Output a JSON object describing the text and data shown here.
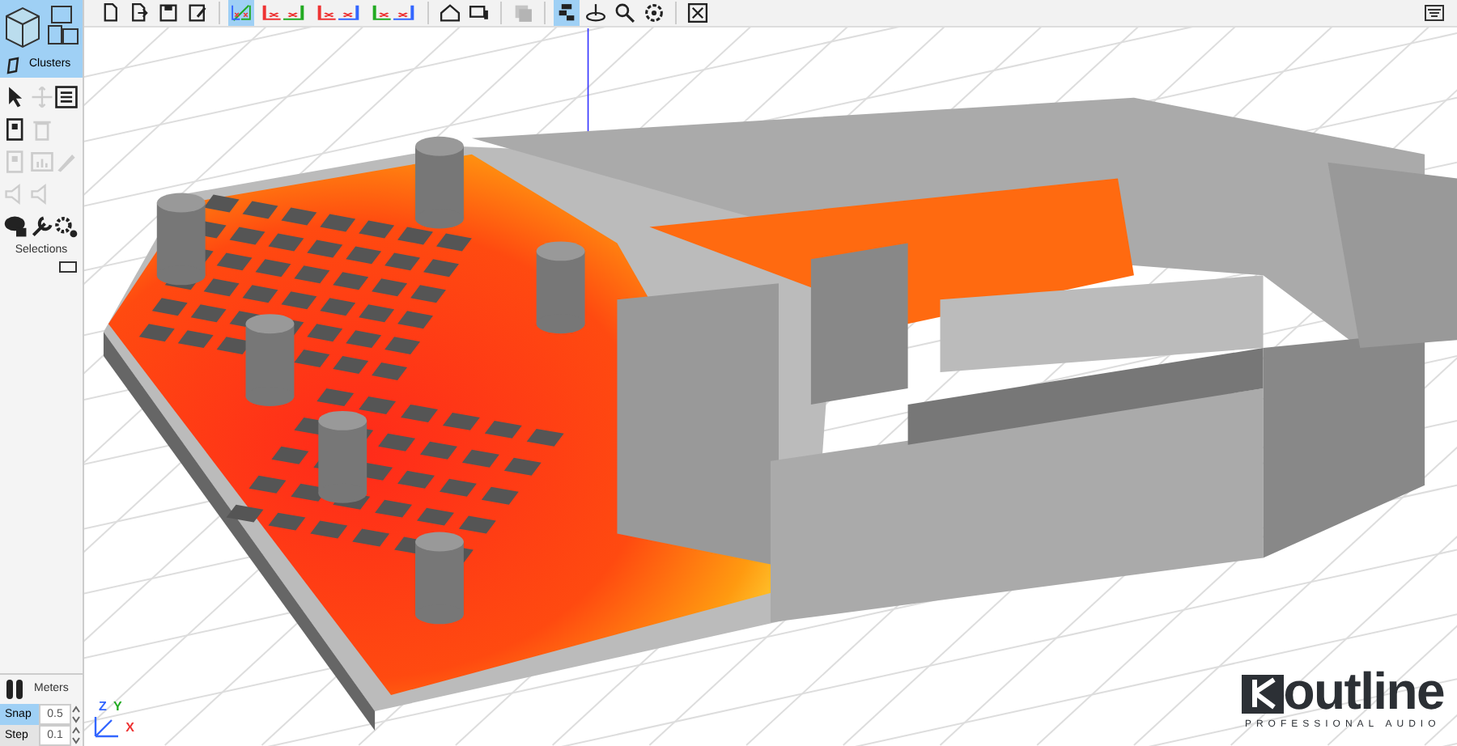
{
  "toolbar": [
    {
      "kind": "new",
      "selected": false,
      "disabled": false
    },
    {
      "kind": "open",
      "selected": false,
      "disabled": false
    },
    {
      "kind": "save",
      "selected": false,
      "disabled": false
    },
    {
      "kind": "save-as",
      "selected": false,
      "disabled": false
    },
    {
      "kind": "view-3d",
      "selected": true,
      "disabled": false
    },
    {
      "kind": "view-xy",
      "selected": false,
      "disabled": false
    },
    {
      "kind": "view-xz",
      "selected": false,
      "disabled": false
    },
    {
      "kind": "view-yz",
      "selected": false,
      "disabled": false
    },
    {
      "kind": "home",
      "selected": false,
      "disabled": false
    },
    {
      "kind": "display",
      "selected": false,
      "disabled": false
    },
    {
      "kind": "layers",
      "selected": false,
      "disabled": true
    },
    {
      "kind": "cluster",
      "selected": true,
      "disabled": false
    },
    {
      "kind": "mapping",
      "selected": false,
      "disabled": false
    },
    {
      "kind": "zoom",
      "selected": false,
      "disabled": false
    },
    {
      "kind": "settings",
      "selected": false,
      "disabled": false
    },
    {
      "kind": "close",
      "selected": false,
      "disabled": false
    }
  ],
  "sidebar": {
    "mode_button": {
      "label": "Clusters",
      "selected": true
    },
    "tools": [
      {
        "kind": "pointer",
        "disabled": false
      },
      {
        "kind": "move",
        "disabled": true
      },
      {
        "kind": "list",
        "disabled": false
      },
      {
        "kind": "export",
        "disabled": false
      },
      {
        "kind": "delete",
        "disabled": true
      },
      {
        "kind": "blank"
      },
      {
        "kind": "export",
        "disabled": true
      },
      {
        "kind": "chart",
        "disabled": true
      },
      {
        "kind": "edit",
        "disabled": true
      },
      {
        "kind": "speaker",
        "disabled": true
      },
      {
        "kind": "speaker",
        "disabled": true
      },
      {
        "kind": "blank"
      },
      {
        "kind": "cluster",
        "disabled": false
      },
      {
        "kind": "wrench",
        "disabled": false
      },
      {
        "kind": "gears",
        "disabled": false
      }
    ],
    "selections_label": "Selections",
    "units_label": "Meters",
    "fields": [
      {
        "label": "Snap",
        "value": "0.5",
        "selected": true
      },
      {
        "label": "Step",
        "value": "0.1",
        "selected": false
      }
    ]
  },
  "gizmo": {
    "labels": [
      "Z",
      "Y",
      "X"
    ]
  },
  "logo": {
    "wordmark": "outline",
    "tagline": "PROFESSIONAL AUDIO"
  }
}
